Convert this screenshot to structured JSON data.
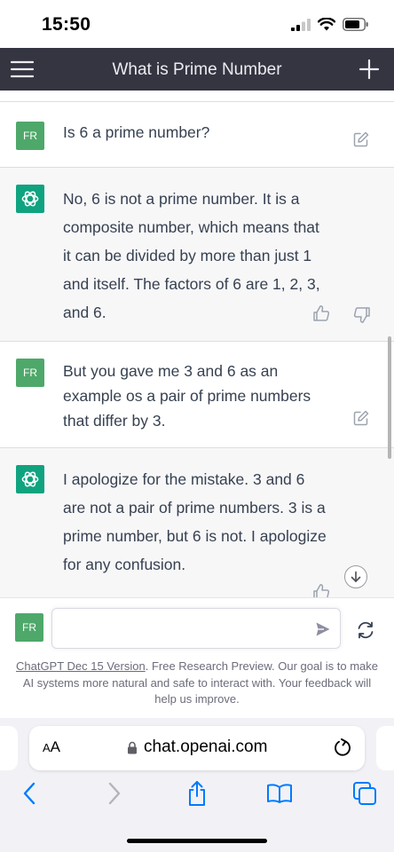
{
  "status_bar": {
    "time": "15:50"
  },
  "header": {
    "title": "What is Prime Number"
  },
  "messages": [
    {
      "role": "user",
      "avatar": "FR",
      "text": "Is 6 a prime number?"
    },
    {
      "role": "assistant",
      "text": "No, 6 is not a prime number. It is a composite number, which means that it can be divided by more than just 1 and itself. The factors of 6 are 1, 2, 3, and 6."
    },
    {
      "role": "user",
      "avatar": "FR",
      "text": "But you gave me 3 and 6 as an example os a pair of prime numbers that differ by 3."
    },
    {
      "role": "assistant",
      "text": "I apologize for the mistake. 3 and 6 are not a pair of prime numbers. 3 is a prime number, but 6 is not. I apologize for any confusion."
    }
  ],
  "composer": {
    "avatar": "FR",
    "value": "",
    "placeholder": ""
  },
  "footer": {
    "link": "ChatGPT Dec 15 Version",
    "text": ". Free Research Preview. Our goal is to make AI systems more natural and safe to interact with. Your feedback will help us improve."
  },
  "safari": {
    "aa_small": "A",
    "aa_large": "A",
    "url": "chat.openai.com"
  },
  "colors": {
    "header_bg": "#343541",
    "user_avatar": "#4ea86a",
    "assistant_avatar": "#10a37f",
    "ios_blue": "#007aff"
  }
}
